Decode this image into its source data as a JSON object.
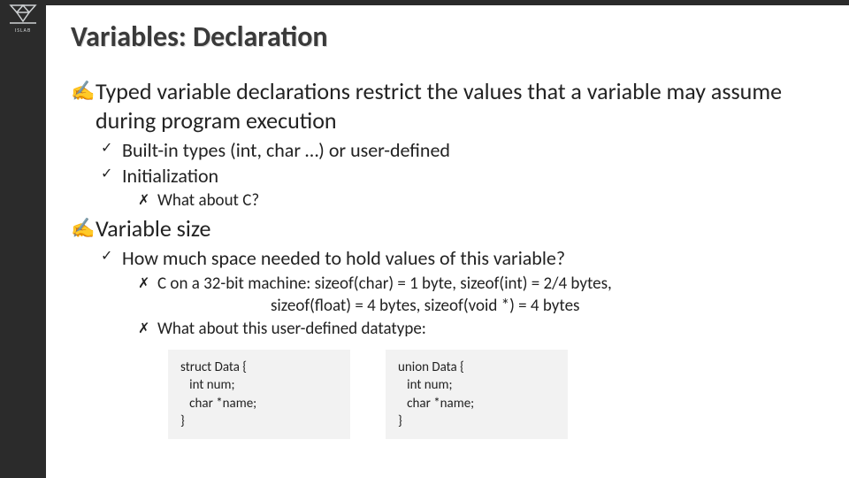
{
  "badge_label": "ISLAB",
  "title": "Variables: Declaration",
  "bullets": {
    "b1": "Typed variable declarations restrict the values that a variable may assume during program execution",
    "b1_1": "Built-in types (int, char …) or user-defined",
    "b1_2": "Initialization",
    "b1_2_1": "What about C?",
    "b2": "Variable size",
    "b2_1": "How much space needed to hold values of this variable?",
    "b2_1_1a": "C on a 32-bit machine: sizeof(char) = 1 byte, sizeof(int) = 2/4 bytes,",
    "b2_1_1b": "sizeof(float) = 4 bytes, sizeof(void *) = 4 bytes",
    "b2_1_2": "What about this user-defined datatype:"
  },
  "code": {
    "struct": "struct Data {\n   int num;\n   char *name;\n}",
    "union": "union Data {\n   int num;\n   char *name;\n}"
  }
}
